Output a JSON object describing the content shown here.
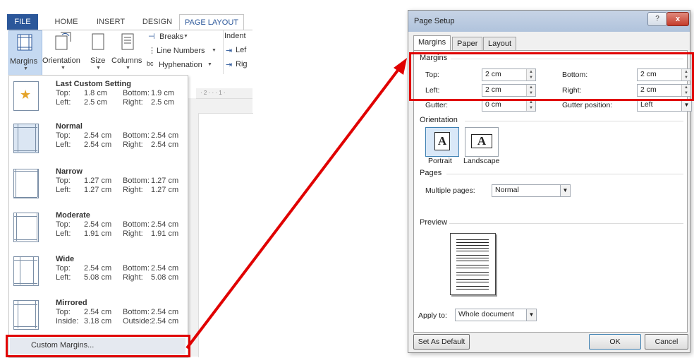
{
  "ribbon": {
    "tabs": [
      "FILE",
      "HOME",
      "INSERT",
      "DESIGN",
      "PAGE LAYOUT"
    ],
    "buttons": {
      "margins": "Margins",
      "orientation": "Orientation",
      "size": "Size",
      "columns": "Columns",
      "breaks": "Breaks",
      "line_numbers": "Line Numbers",
      "hyphenation": "Hyphenation",
      "indent": "Indent",
      "left_partial": "Lef",
      "right_partial": "Rig"
    },
    "ruler_text": "· 2 · · · 1 ·"
  },
  "margins_menu": {
    "items": [
      {
        "name": "Last Custom Setting",
        "r1a": "Top:",
        "r1b": "1.8 cm",
        "r1c": "Bottom:",
        "r1d": "1.9 cm",
        "r2a": "Left:",
        "r2b": "2.5 cm",
        "r2c": "Right:",
        "r2d": "2.5 cm"
      },
      {
        "name": "Normal",
        "r1a": "Top:",
        "r1b": "2.54 cm",
        "r1c": "Bottom:",
        "r1d": "2.54 cm",
        "r2a": "Left:",
        "r2b": "2.54 cm",
        "r2c": "Right:",
        "r2d": "2.54 cm"
      },
      {
        "name": "Narrow",
        "r1a": "Top:",
        "r1b": "1.27 cm",
        "r1c": "Bottom:",
        "r1d": "1.27 cm",
        "r2a": "Left:",
        "r2b": "1.27 cm",
        "r2c": "Right:",
        "r2d": "1.27 cm"
      },
      {
        "name": "Moderate",
        "r1a": "Top:",
        "r1b": "2.54 cm",
        "r1c": "Bottom:",
        "r1d": "2.54 cm",
        "r2a": "Left:",
        "r2b": "1.91 cm",
        "r2c": "Right:",
        "r2d": "1.91 cm"
      },
      {
        "name": "Wide",
        "r1a": "Top:",
        "r1b": "2.54 cm",
        "r1c": "Bottom:",
        "r1d": "2.54 cm",
        "r2a": "Left:",
        "r2b": "5.08 cm",
        "r2c": "Right:",
        "r2d": "5.08 cm"
      },
      {
        "name": "Mirrored",
        "r1a": "Top:",
        "r1b": "2.54 cm",
        "r1c": "Bottom:",
        "r1d": "2.54 cm",
        "r2a": "Inside:",
        "r2b": "3.18 cm",
        "r2c": "Outside:",
        "r2d": "2.54 cm"
      }
    ],
    "custom_margins": "Custom Margins..."
  },
  "dialog": {
    "title": "Page Setup",
    "help": "?",
    "close": "x",
    "tabs": [
      "Margins",
      "Paper",
      "Layout"
    ],
    "margins_section": "Margins",
    "top_label": "Top:",
    "top_value": "2 cm",
    "bottom_label": "Bottom:",
    "bottom_value": "2 cm",
    "left_label": "Left:",
    "left_value": "2 cm",
    "right_label": "Right:",
    "right_value": "2 cm",
    "gutter_label": "Gutter:",
    "gutter_value": "0 cm",
    "gutter_pos_label": "Gutter position:",
    "gutter_pos_value": "Left",
    "orientation_section": "Orientation",
    "portrait": "Portrait",
    "landscape": "Landscape",
    "pages_section": "Pages",
    "multiple_pages_label": "Multiple pages:",
    "multiple_pages_value": "Normal",
    "preview_section": "Preview",
    "apply_to_label": "Apply to:",
    "apply_to_value": "Whole document",
    "set_default": "Set As Default",
    "ok": "OK",
    "cancel": "Cancel"
  },
  "colors": {
    "highlight": "#e00000",
    "file_tab": "#2b579a"
  }
}
